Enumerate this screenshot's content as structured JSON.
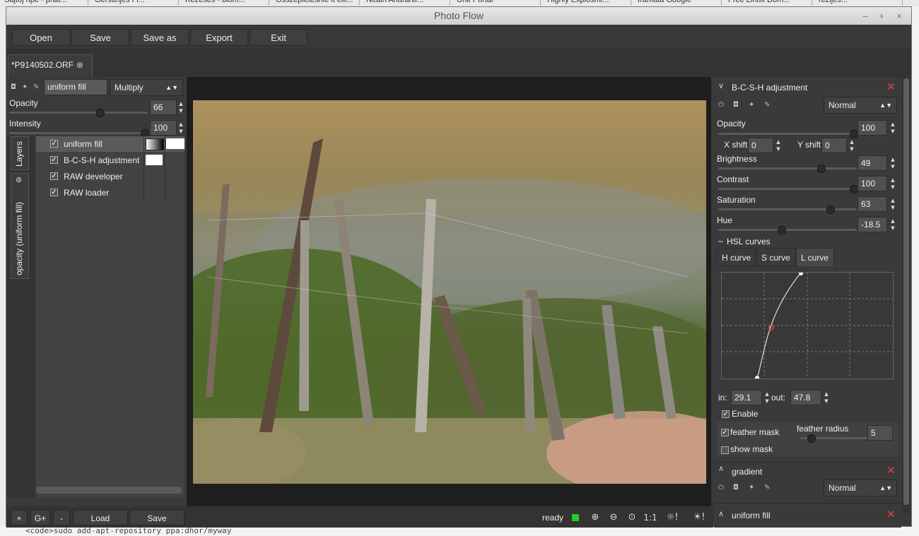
{
  "browser_tabs": [
    "Sajtój hpe - prall...",
    "Gersteijes Fl...",
    "Kezeses - blom...",
    "Osszepletesnie it elli...",
    "Nealh Andrahir...",
    "Unk Portal",
    "Highly Explosmi...",
    "Iramata Google",
    "Free Linux Dom...",
    "rezijes..."
  ],
  "page_bottom_text": "<code>sudo add-apt-repository ppa:dhor/myway",
  "window": {
    "title": "Photo Flow",
    "min": "–",
    "max": "+",
    "close": "×"
  },
  "menu": {
    "open": "Open",
    "save": "Save",
    "save_as": "Save as",
    "export": "Export",
    "exit": "Exit"
  },
  "doc_tab": {
    "label": "*P9140502.ORF",
    "close": "⊗"
  },
  "layer_controls": {
    "name_value": "uniform fill",
    "blend_mode": "Multiply",
    "opacity_label": "Opacity",
    "opacity_value": "66",
    "opacity_level": 0.66,
    "intensity_label": "Intensity",
    "intensity_value": "100",
    "intensity_level": 1.0
  },
  "side_tabs": {
    "layers": "Layers",
    "opacity": "opacity (uniform fill)"
  },
  "layers": [
    {
      "name": "uniform fill",
      "checked": true,
      "selected": true
    },
    {
      "name": "B-C-S-H adjustment",
      "checked": true,
      "selected": false
    },
    {
      "name": "RAW developer",
      "checked": true,
      "selected": false
    },
    {
      "name": "RAW loader",
      "checked": true,
      "selected": false
    }
  ],
  "bottom_left": {
    "add": "+",
    "group": "G+",
    "remove": "-",
    "load": "Load",
    "save": "Save"
  },
  "status": {
    "text": "ready",
    "color": "#22cc22"
  },
  "zoom_buttons": {
    "zoom_in": "⊕",
    "zoom_out": "⊖",
    "zoom_fit": "⊙",
    "one_to_one": "1:1",
    "shadows": "☼!",
    "highlights": "☀!"
  },
  "bcsh": {
    "title": "B-C-S-H adjustment",
    "blend": "Normal",
    "opacity_label": "Opacity",
    "opacity_value": "100",
    "opacity_level": 1.0,
    "xshift_label": "X shift",
    "xshift_value": "0",
    "yshift_label": "Y shift",
    "yshift_value": "0",
    "brightness_label": "Brightness",
    "brightness_value": "49",
    "brightness_level": 0.75,
    "contrast_label": "Contrast",
    "contrast_value": "100",
    "contrast_level": 1.0,
    "saturation_label": "Saturation",
    "saturation_value": "63",
    "saturation_level": 0.82,
    "hue_label": "Hue",
    "hue_value": "-18.5",
    "hue_level": 0.45,
    "hsl_curves_label": "HSL curves",
    "curve_tabs": [
      "H curve",
      "S curve",
      "L curve"
    ],
    "active_curve_tab": 2,
    "in_label": "in:",
    "in_value": "29.1",
    "out_label": "out:",
    "out_value": "47.8",
    "enable_label": "Enable",
    "feather_mask_label": "feather mask",
    "feather_radius_label": "feather radius",
    "feather_radius_value": "5",
    "show_mask_label": "show mask"
  },
  "gradient": {
    "title": "gradient",
    "blend": "Normal"
  },
  "uniform_fill": {
    "title": "uniform fill"
  },
  "colors": {
    "accent_close": "#e04040",
    "swatch_white": "#ffffff"
  }
}
